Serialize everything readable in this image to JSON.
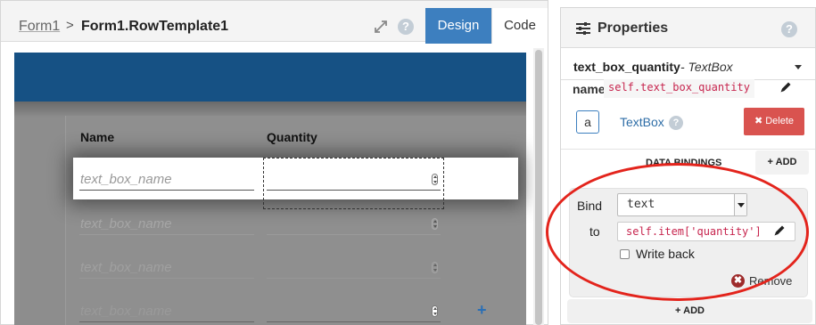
{
  "designer": {
    "breadcrumb_root": "Form1",
    "breadcrumb_separator": ">",
    "breadcrumb_current": "Form1.RowTemplate1",
    "help_glyph": "?",
    "tabs": {
      "design": "Design",
      "code": "Code"
    },
    "active_tab": "design",
    "header_color": "#165184",
    "columns": [
      "Name",
      "Quantity"
    ],
    "rows": [
      {
        "name_placeholder": "text_box_name",
        "selected": true
      },
      {
        "name_placeholder": "text_box_name",
        "selected": false
      },
      {
        "name_placeholder": "text_box_name",
        "selected": false
      },
      {
        "name_placeholder": "text_box_name",
        "selected": false
      }
    ],
    "add_row_glyph": "+"
  },
  "properties": {
    "title": "Properties",
    "help_glyph": "?",
    "component_name": "text_box_quantity",
    "component_type": " - TextBox",
    "name_label": "name",
    "name_value": "self.text_box_quantity",
    "component_icon_glyph": "a",
    "component_type_link": "TextBox",
    "delete_label": "✖ Delete",
    "delete_color": "#d9534f",
    "data_bindings_title": "DATA BINDINGS",
    "add_label": "+ ADD",
    "binding": {
      "bind_label": "Bind",
      "bind_property": "text",
      "to_label": "to",
      "to_expression": "self.item['quantity']",
      "write_back_label": "Write back",
      "write_back_checked": false,
      "remove_glyph": "✖",
      "remove_label": "Remove"
    },
    "add_wide_label": "+ ADD"
  },
  "highlight_color": "#e3241c"
}
